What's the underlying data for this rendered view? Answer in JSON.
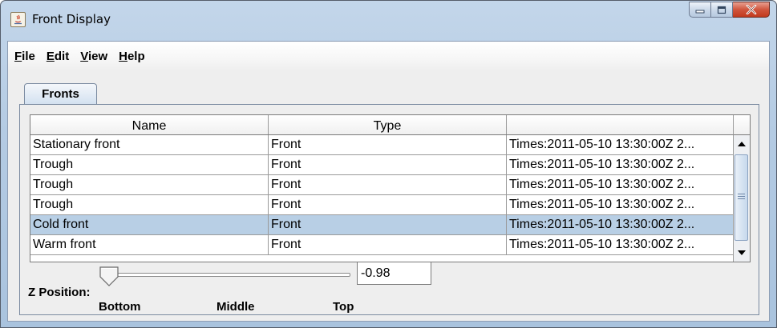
{
  "window": {
    "title": "Front Display",
    "controls": {
      "minimize": "minimize-icon",
      "maximize": "maximize-icon",
      "close": "close-icon"
    }
  },
  "menubar": {
    "items": [
      {
        "first": "F",
        "rest": "ile"
      },
      {
        "first": "E",
        "rest": "dit"
      },
      {
        "first": "V",
        "rest": "iew"
      },
      {
        "first": "H",
        "rest": "elp"
      }
    ]
  },
  "tabs": [
    {
      "label": "Fronts",
      "selected": true
    }
  ],
  "table": {
    "columns": [
      "Name",
      "Type",
      ""
    ],
    "rows": [
      {
        "name": "Stationary front",
        "type": "Front",
        "times": "Times:2011-05-10 13:30:00Z 2...",
        "selected": false
      },
      {
        "name": "Trough",
        "type": "Front",
        "times": "Times:2011-05-10 13:30:00Z 2...",
        "selected": false
      },
      {
        "name": "Trough",
        "type": "Front",
        "times": "Times:2011-05-10 13:30:00Z 2...",
        "selected": false
      },
      {
        "name": "Trough",
        "type": "Front",
        "times": "Times:2011-05-10 13:30:00Z 2...",
        "selected": false
      },
      {
        "name": "Cold front",
        "type": "Front",
        "times": "Times:2011-05-10 13:30:00Z 2...",
        "selected": true
      },
      {
        "name": "Warm front",
        "type": "Front",
        "times": "Times:2011-05-10 13:30:00Z 2...",
        "selected": false
      }
    ]
  },
  "z_position": {
    "label": "Z Position:",
    "value": "-0.98",
    "slider_labels": {
      "bottom": "Bottom",
      "middle": "Middle",
      "top": "Top"
    }
  },
  "colors": {
    "selected_row": "#b8cfe5",
    "close_button": "#c94a30",
    "title_gradient": "#b4cbe3"
  }
}
